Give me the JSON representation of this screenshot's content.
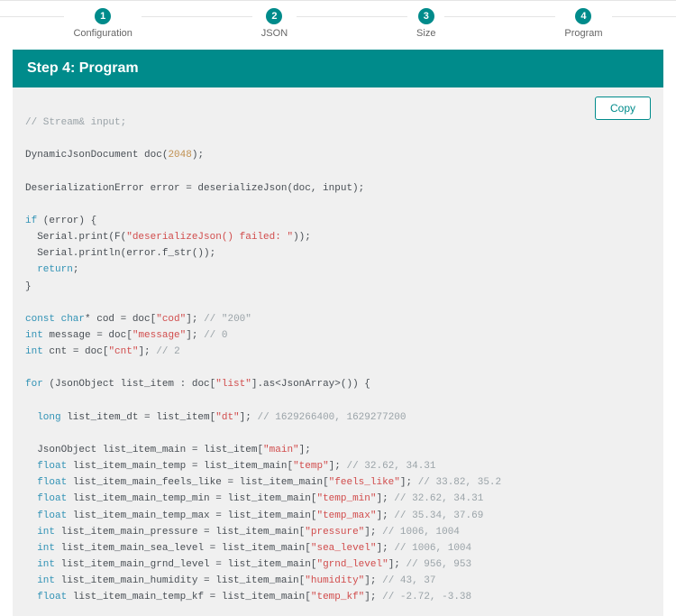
{
  "stepper": {
    "steps": [
      {
        "num": "1",
        "label": "Configuration"
      },
      {
        "num": "2",
        "label": "JSON"
      },
      {
        "num": "3",
        "label": "Size"
      },
      {
        "num": "4",
        "label": "Program"
      }
    ]
  },
  "panel": {
    "title": "Step 4: Program"
  },
  "copy_button": "Copy",
  "code": {
    "l01_c": "// Stream& input;",
    "l02a": "DynamicJsonDocument doc(",
    "l02n": "2048",
    "l02b": ");",
    "l03a": "DeserializationError error = deserializeJson(doc, input);",
    "l04_kw": "if",
    "l04_rest": " (error) {",
    "l05a": "  Serial.print(F(",
    "l05s": "\"deserializeJson() failed: \"",
    "l05b": "));",
    "l06": "  Serial.println(error.f_str());",
    "l07_kw": "  return",
    "l07b": ";",
    "l08": "}",
    "l09_kw": "const char",
    "l09a": "* cod = doc[",
    "l09s": "\"cod\"",
    "l09b": "]; ",
    "l09c": "// \"200\"",
    "l10_kw": "int",
    "l10a": " message = doc[",
    "l10s": "\"message\"",
    "l10b": "]; ",
    "l10c": "// 0",
    "l11_kw": "int",
    "l11a": " cnt = doc[",
    "l11s": "\"cnt\"",
    "l11b": "]; ",
    "l11c": "// 2",
    "l12_kw": "for",
    "l12a": " (JsonObject list_item : doc[",
    "l12s": "\"list\"",
    "l12b": "].as<JsonArray>()) {",
    "l13_kw": "  long",
    "l13a": " list_item_dt = list_item[",
    "l13s": "\"dt\"",
    "l13b": "]; ",
    "l13c": "// 1629266400, 1629277200",
    "l14a": "  JsonObject list_item_main = list_item[",
    "l14s": "\"main\"",
    "l14b": "];",
    "l15_kw": "  float",
    "l15a": " list_item_main_temp = list_item_main[",
    "l15s": "\"temp\"",
    "l15b": "]; ",
    "l15c": "// 32.62, 34.31",
    "l16_kw": "  float",
    "l16a": " list_item_main_feels_like = list_item_main[",
    "l16s": "\"feels_like\"",
    "l16b": "]; ",
    "l16c": "// 33.82, 35.2",
    "l17_kw": "  float",
    "l17a": " list_item_main_temp_min = list_item_main[",
    "l17s": "\"temp_min\"",
    "l17b": "]; ",
    "l17c": "// 32.62, 34.31",
    "l18_kw": "  float",
    "l18a": " list_item_main_temp_max = list_item_main[",
    "l18s": "\"temp_max\"",
    "l18b": "]; ",
    "l18c": "// 35.34, 37.69",
    "l19_kw": "  int",
    "l19a": " list_item_main_pressure = list_item_main[",
    "l19s": "\"pressure\"",
    "l19b": "]; ",
    "l19c": "// 1006, 1004",
    "l20_kw": "  int",
    "l20a": " list_item_main_sea_level = list_item_main[",
    "l20s": "\"sea_level\"",
    "l20b": "]; ",
    "l20c": "// 1006, 1004",
    "l21_kw": "  int",
    "l21a": " list_item_main_grnd_level = list_item_main[",
    "l21s": "\"grnd_level\"",
    "l21b": "]; ",
    "l21c": "// 956, 953",
    "l22_kw": "  int",
    "l22a": " list_item_main_humidity = list_item_main[",
    "l22s": "\"humidity\"",
    "l22b": "]; ",
    "l22c": "// 43, 37",
    "l23_kw": "  float",
    "l23a": " list_item_main_temp_kf = list_item_main[",
    "l23s": "\"temp_kf\"",
    "l23b": "]; ",
    "l23c": "// -2.72, -3.38"
  }
}
